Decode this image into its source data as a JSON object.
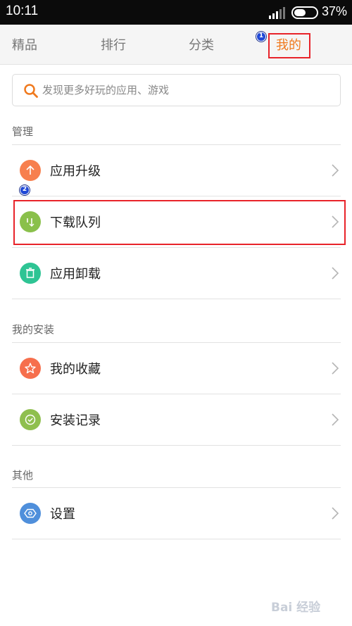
{
  "status_bar": {
    "time": "10:11",
    "battery_percent": "37%",
    "battery_level": 0.37
  },
  "tabs": [
    {
      "label": "精品",
      "active": false
    },
    {
      "label": "排行",
      "active": false
    },
    {
      "label": "分类",
      "active": false
    },
    {
      "label": "我的",
      "active": true
    }
  ],
  "annotations": {
    "marker_1": "1",
    "marker_2": "2"
  },
  "search": {
    "placeholder": "发现更多好玩的应用、游戏",
    "icon": "search-icon"
  },
  "sections": [
    {
      "title": "管理",
      "items": [
        {
          "label": "应用升级",
          "icon": "upgrade-arrow-icon",
          "color": "#f77f4e"
        },
        {
          "label": "下载队列",
          "icon": "download-queue-icon",
          "color": "#8ac04b"
        },
        {
          "label": "应用卸载",
          "icon": "trash-icon",
          "color": "#2ec494"
        }
      ]
    },
    {
      "title": "我的安装",
      "items": [
        {
          "label": "我的收藏",
          "icon": "star-icon",
          "color": "#f66f4d"
        },
        {
          "label": "安装记录",
          "icon": "check-icon",
          "color": "#8fbf4e"
        }
      ]
    },
    {
      "title": "其他",
      "items": [
        {
          "label": "设置",
          "icon": "settings-hexagon-icon",
          "color": "#4f8fdb"
        }
      ]
    }
  ],
  "colors": {
    "accent": "#f07a1e",
    "highlight_border": "#e8232a",
    "marker": "#2149d6"
  },
  "watermark": {
    "text": "Bai 经验"
  }
}
